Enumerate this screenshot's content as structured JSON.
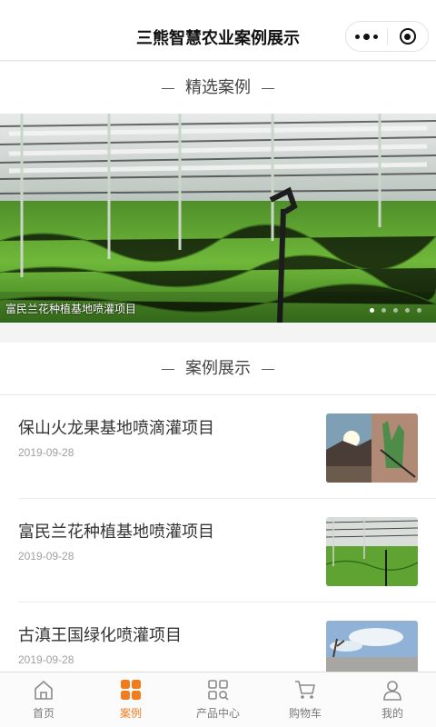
{
  "header": {
    "title": "三熊智慧农业案例展示"
  },
  "featured": {
    "heading": "精选案例",
    "banner_caption": "富民兰花种植基地喷灌项目",
    "carousel_count": 5,
    "carousel_active": 0
  },
  "cases": {
    "heading": "案例展示",
    "items": [
      {
        "title": "保山火龙果基地喷滴灌项目",
        "date": "2019-09-28"
      },
      {
        "title": "富民兰花种植基地喷灌项目",
        "date": "2019-09-28"
      },
      {
        "title": "古滇王国绿化喷灌项目",
        "date": "2019-09-28"
      }
    ]
  },
  "tabbar": {
    "items": [
      {
        "label": "首页",
        "icon": "home-icon"
      },
      {
        "label": "案例",
        "icon": "grid-icon",
        "active": true
      },
      {
        "label": "产品中心",
        "icon": "products-icon"
      },
      {
        "label": "购物车",
        "icon": "cart-icon"
      },
      {
        "label": "我的",
        "icon": "user-icon"
      }
    ],
    "active_color": "#f07c1e",
    "inactive_color": "#7a7a7a"
  }
}
